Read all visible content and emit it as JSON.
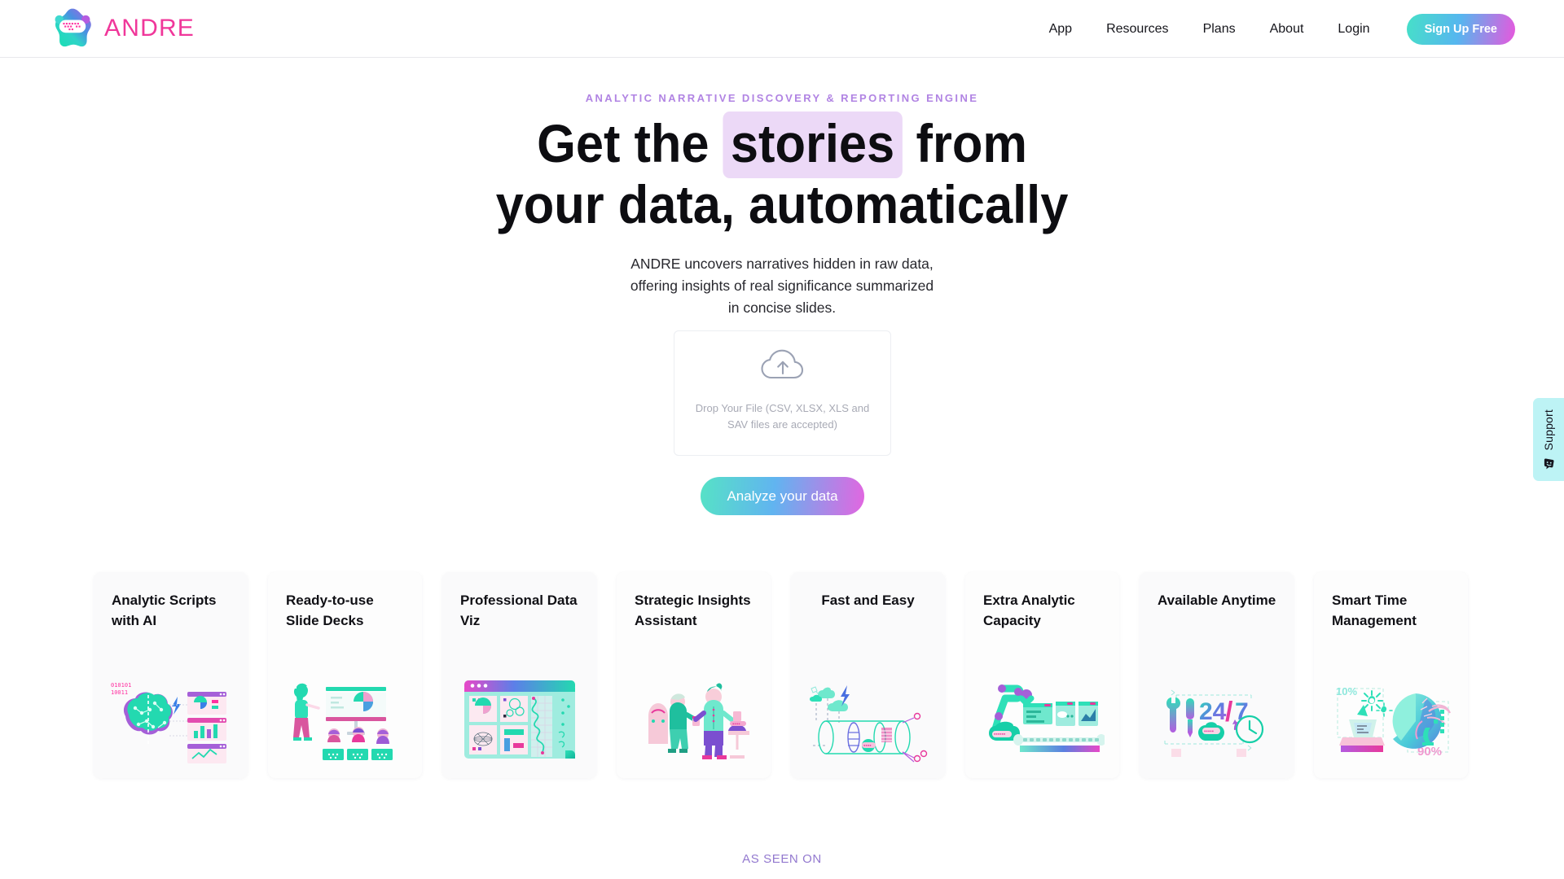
{
  "brand": {
    "name": "ANDRE",
    "logo_icon": "andre-blob-logo",
    "name_color": "#f0379a"
  },
  "header": {
    "nav_links": [
      {
        "label": "App"
      },
      {
        "label": "Resources"
      },
      {
        "label": "Plans"
      },
      {
        "label": "About"
      },
      {
        "label": "Login"
      }
    ],
    "cta": {
      "label": "Sign Up Free",
      "gradient_from": "#46e0c8",
      "gradient_mid": "#56b6ef",
      "gradient_to": "#e857dd"
    }
  },
  "hero": {
    "eyebrow": "ANALYTIC NARRATIVE DISCOVERY & REPORTING ENGINE",
    "eyebrow_color": "#b184e3",
    "headline_part1": "Get the",
    "headline_highlight": "stories",
    "headline_part2": "from",
    "headline_line2": "your data, automatically",
    "highlight_color": "#ecd9f7",
    "subtitle_line1": "ANDRE uncovers narratives hidden in raw data,",
    "subtitle_line2": "offering insights of real significance summarized",
    "subtitle_line3": "in concise slides."
  },
  "dropzone": {
    "icon": "cloud-upload-icon",
    "text": "Drop Your File (CSV, XLSX, XLS and SAV files are accepted)",
    "accepted_formats": [
      "CSV",
      "XLSX",
      "XLS",
      "SAV"
    ]
  },
  "analyze": {
    "label": "Analyze your data"
  },
  "cards": [
    {
      "title": "Analytic Scripts with AI",
      "art": "brain-ai-charts",
      "align": "left",
      "tint": true
    },
    {
      "title": "Ready-to-use Slide Decks",
      "art": "presentation-audience",
      "align": "left",
      "tint": false
    },
    {
      "title": "Professional Data Viz",
      "art": "dashboard-window",
      "align": "left",
      "tint": true
    },
    {
      "title": "Strategic Insights Assistant",
      "art": "two-people-chart",
      "align": "left",
      "tint": false
    },
    {
      "title": "Fast and Easy",
      "art": "pipeline-cloud",
      "align": "center",
      "tint": true
    },
    {
      "title": "Extra Analytic Capacity",
      "art": "robot-arm-conveyor",
      "align": "left",
      "tint": false
    },
    {
      "title": "Available Anytime",
      "art": "tools-24-7-clock",
      "align": "left",
      "tint": true
    },
    {
      "title": "Smart Time Management",
      "art": "pie-chart-laptop",
      "align": "left",
      "tint": false
    }
  ],
  "support": {
    "label": "Support",
    "icon": "smiley-face-icon",
    "background": "#bdf3f5"
  },
  "footer": {
    "as_seen_on": "AS SEEN ON",
    "as_seen_on_color": "#9379cf"
  }
}
